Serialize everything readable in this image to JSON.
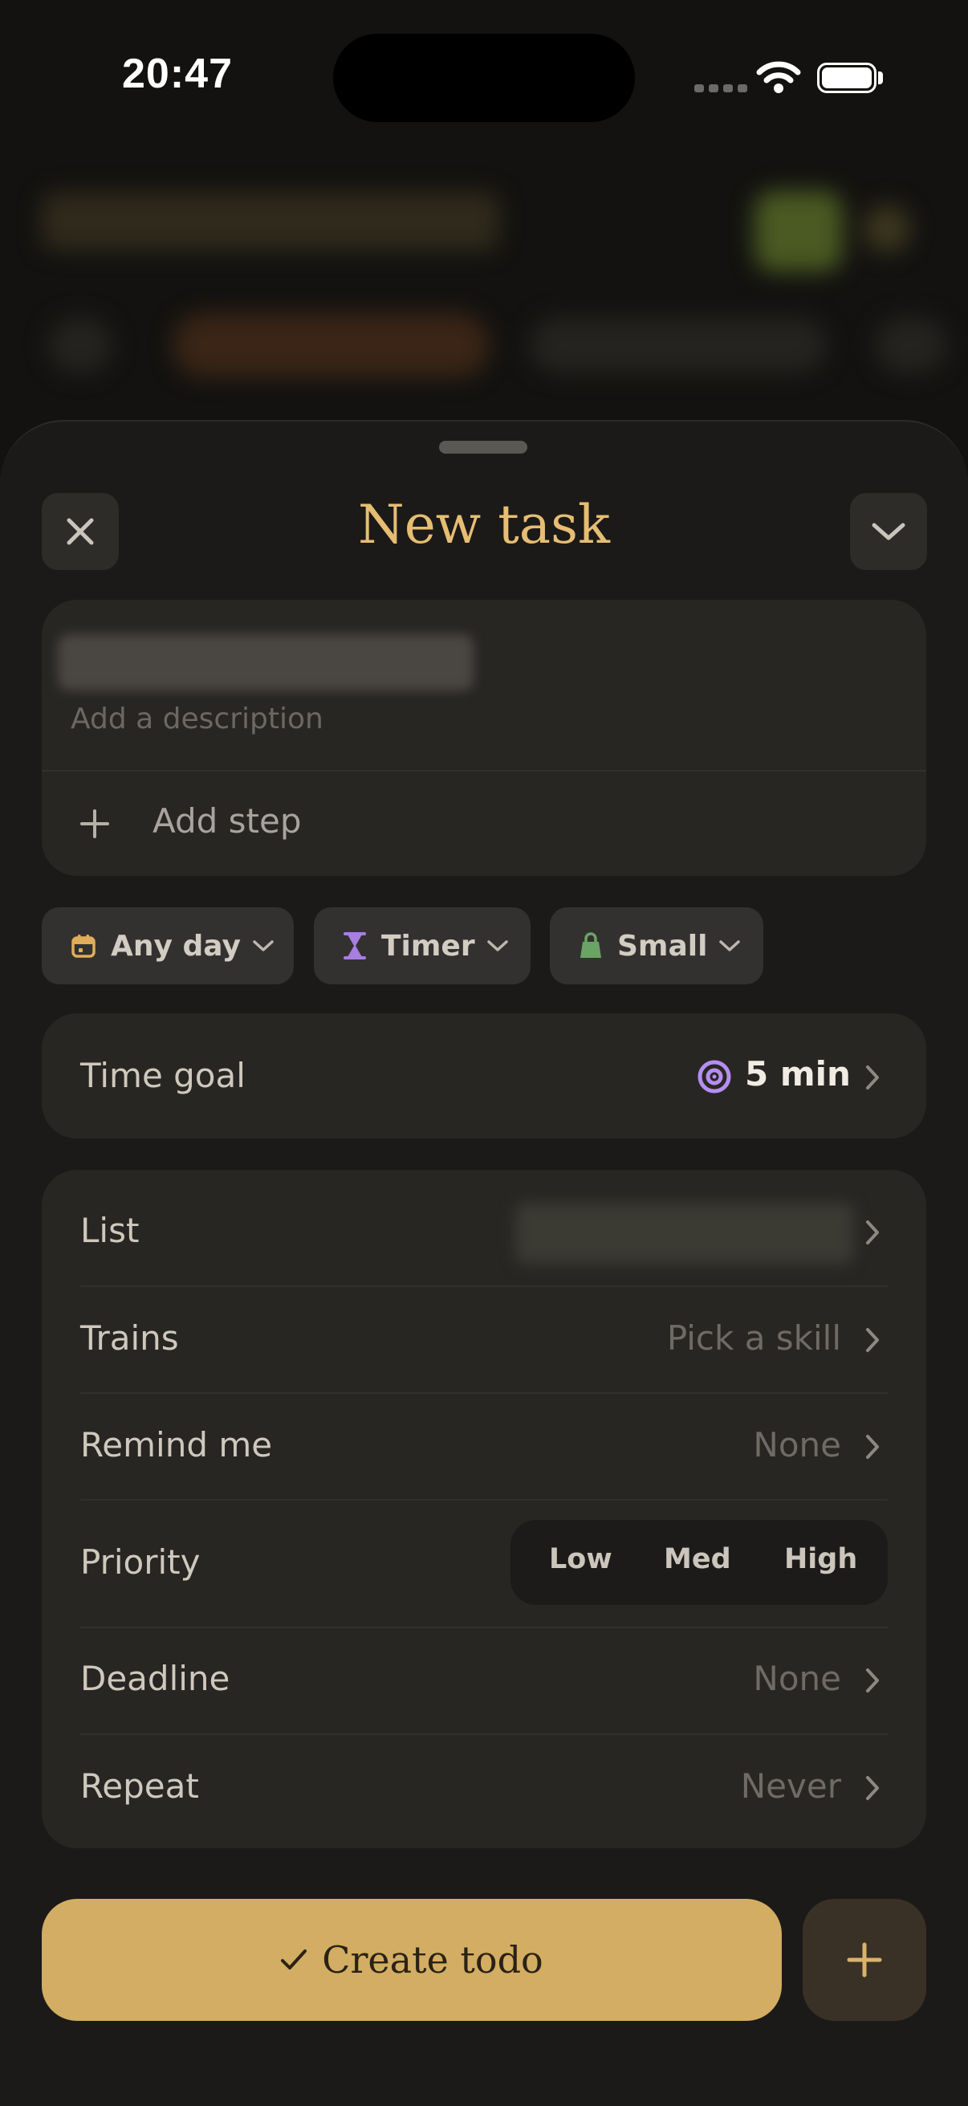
{
  "status_bar": {
    "time": "20:47"
  },
  "sheet": {
    "title": "New task",
    "close_icon": "close-icon",
    "collapse_icon": "chevron-down-icon"
  },
  "task": {
    "description_placeholder": "Add a description",
    "add_step_label": "Add step"
  },
  "chips": [
    {
      "label": "Any day",
      "icon": "calendar-icon"
    },
    {
      "label": "Timer",
      "icon": "hourglass-icon"
    },
    {
      "label": "Small",
      "icon": "weight-icon"
    }
  ],
  "time_goal": {
    "label": "Time goal",
    "value": "5 min",
    "icon": "target-icon"
  },
  "settings": {
    "list": {
      "label": "List"
    },
    "trains": {
      "label": "Trains",
      "value": "Pick a skill"
    },
    "remind": {
      "label": "Remind me",
      "value": "None"
    },
    "priority": {
      "label": "Priority",
      "options": [
        "Low",
        "Med",
        "High"
      ]
    },
    "deadline": {
      "label": "Deadline",
      "value": "None"
    },
    "repeat": {
      "label": "Repeat",
      "value": "Never"
    }
  },
  "actions": {
    "create_label": "Create todo"
  },
  "colors": {
    "accent": "#e6bd73",
    "button": "#d2ad63",
    "sheet_bg": "#1b1a18",
    "card_bg": "#282623",
    "timer_icon": "#a77fe0",
    "size_icon": "#69a465",
    "calendar_icon": "#e0ae5a"
  }
}
